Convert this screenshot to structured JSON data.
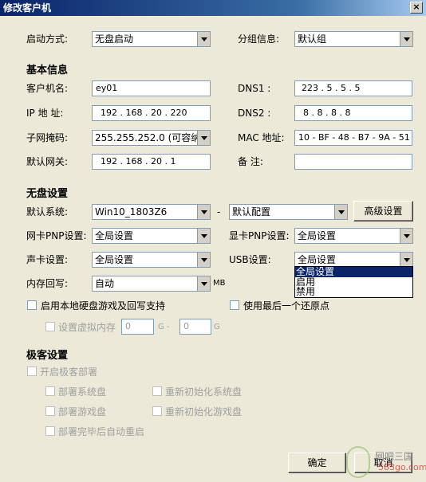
{
  "window": {
    "title": "修改客户机",
    "close": "×"
  },
  "boot": {
    "label": "启动方式:",
    "value": "无盘启动"
  },
  "group": {
    "label": "分组信息:",
    "value": "默认组"
  },
  "basic": {
    "header": "基本信息",
    "client_name_label": "客户机名:",
    "client_name": "ey01",
    "ip_label": "IP 地 址:",
    "ip": "192 . 168 . 20 . 220",
    "mask_label": "子网掩码:",
    "mask": "255.255.252.0  (可容纳",
    "gateway_label": "默认网关:",
    "gateway": "192 . 168 . 20 . 1",
    "dns1_label": "DNS1    :",
    "dns1": "223 . 5 . 5 . 5",
    "dns2_label": "DNS2    :",
    "dns2": "8 . 8 . 8 . 8",
    "mac_label": "MAC 地址:",
    "mac": "10 - BF - 48 - B7 - 9A - 51",
    "note_label": "备    注:",
    "note": ""
  },
  "diskless": {
    "header": "无盘设置",
    "default_os_label": "默认系统:",
    "default_os": "Win10_1803Z6",
    "dash": "-",
    "config": "默认配置",
    "advanced_btn": "高级设置",
    "nic_label": "网卡PNP设置:",
    "nic": "全局设置",
    "gpu_label": "显卡PNP设置:",
    "gpu": "全局设置",
    "sound_label": "声卡设置:",
    "sound": "全局设置",
    "usb_label": "USB设置:",
    "usb": "全局设置",
    "usb_options": [
      "全局设置",
      "启用",
      "禁用"
    ],
    "memwb_label": "内存回写:",
    "memwb": "自动",
    "memwb_unit": "MB",
    "local_disk_label": "启用本地硬盘游戏及回写支持",
    "restore_label": "使用最后一个还原点",
    "vmem_label": "设置虚拟内存",
    "vmem_from": "0",
    "vmem_g1": "G -",
    "vmem_to": "0",
    "vmem_g2": "G"
  },
  "deploy": {
    "header": "极客设置",
    "enable_label": "开启极客部署",
    "sys_disk": "部署系统盘",
    "reinit_sys": "重新初始化系统盘",
    "game_disk": "部署游戏盘",
    "reinit_game": "重新初始化游戏盘",
    "auto_reboot": "部署完毕后自动重启"
  },
  "buttons": {
    "ok": "确定",
    "cancel": "取消"
  },
  "watermark": {
    "line1": "网吧三国",
    "line2": "583go.com"
  }
}
